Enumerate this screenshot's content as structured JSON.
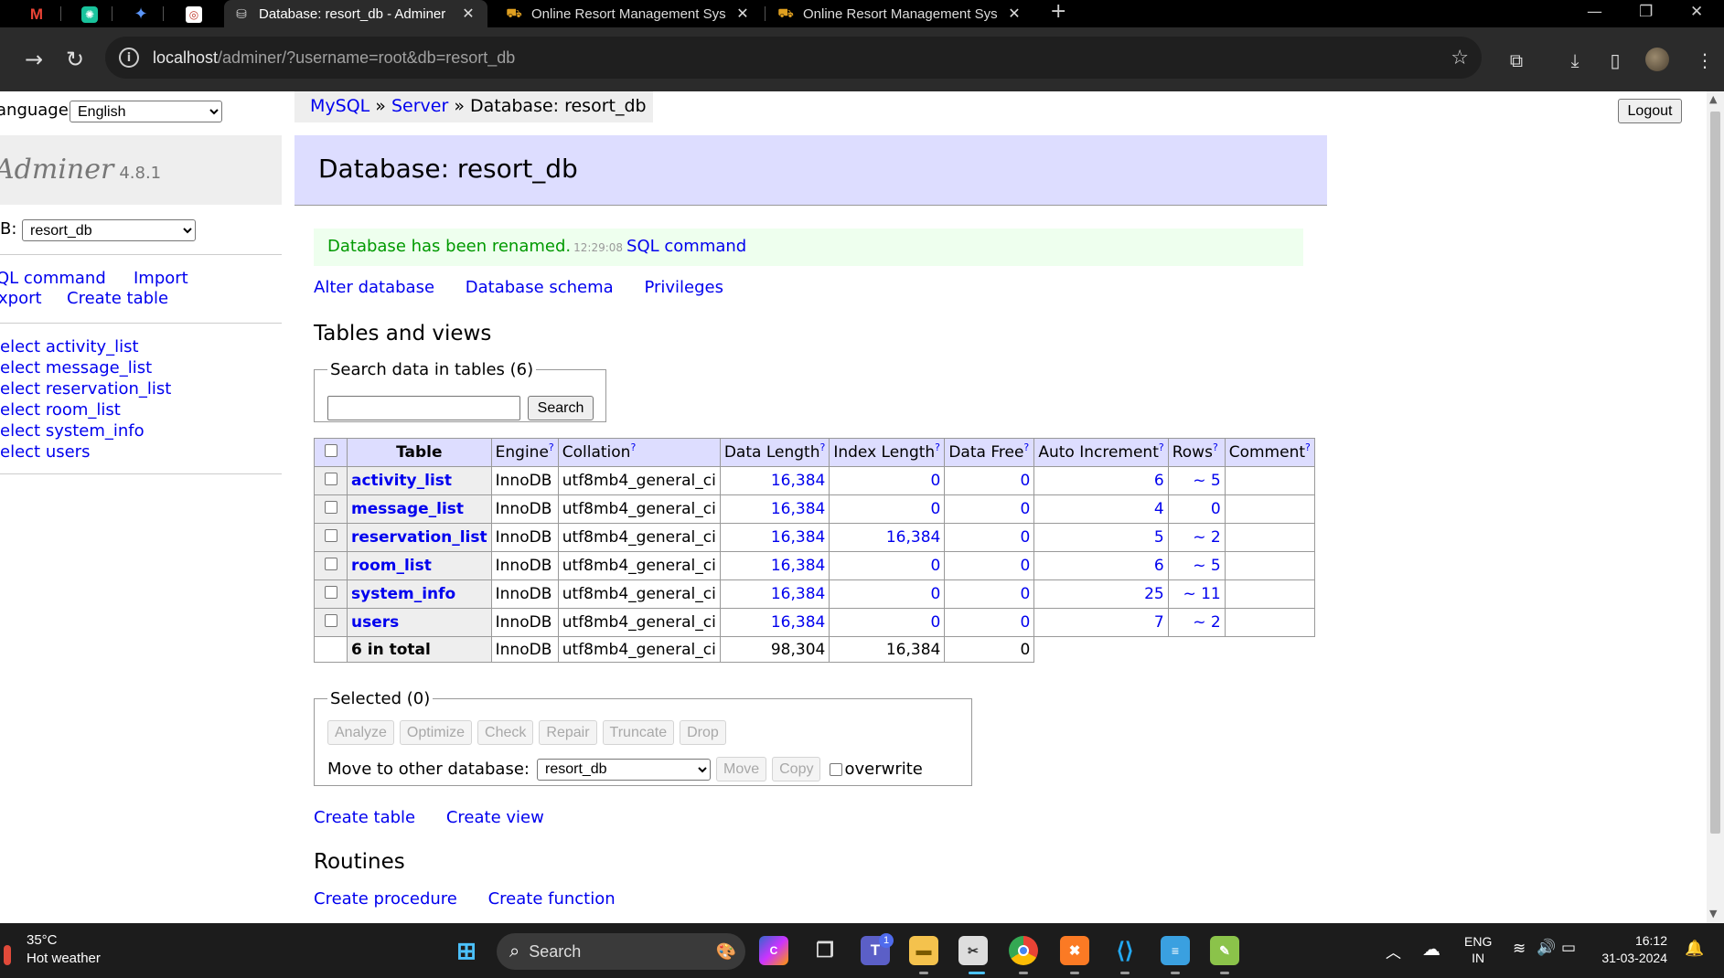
{
  "browser": {
    "pinned_tabs": [
      {
        "icon": "gmail-icon",
        "glyph": "M",
        "color": "#ea4335"
      },
      {
        "icon": "chatgpt-icon",
        "glyph": "✺",
        "color": "#10a37f"
      },
      {
        "icon": "gemini-icon",
        "glyph": "✦",
        "color": "#4f8df7"
      },
      {
        "icon": "pocket-icon",
        "glyph": "◎",
        "color": "#e0e0e0"
      }
    ],
    "tabs": [
      {
        "title": "Database: resort_db - Adminer",
        "active": true
      },
      {
        "title": "Online Resort Management Sys",
        "active": false
      },
      {
        "title": "Online Resort Management Sys",
        "active": false
      }
    ],
    "url_host": "localhost",
    "url_path": "/adminer/?username=root&db=resort_db"
  },
  "menu": {
    "language_label": "anguage:",
    "language_value": "English",
    "brand": "Adminer",
    "version": "4.8.1",
    "db_label": "B:",
    "db_value": "resort_db",
    "links": [
      {
        "label": "QL command",
        "name": "sql-command-link"
      },
      {
        "label": "Import",
        "name": "import-link"
      },
      {
        "label": "xport",
        "name": "export-link"
      },
      {
        "label": "Create table",
        "name": "create-table-link"
      }
    ],
    "tables": [
      "elect activity_list",
      "elect message_list",
      "elect reservation_list",
      "elect room_list",
      "elect system_info",
      "elect users"
    ]
  },
  "breadcrumb": {
    "mysql": "MySQL",
    "sep1": "»",
    "server": "Server",
    "sep2": "»",
    "current": "Database: resort_db"
  },
  "logout_label": "Logout",
  "heading": "Database: resort_db",
  "message": {
    "text": "Database has been renamed.",
    "time": "12:29:08",
    "link": "SQL command"
  },
  "db_links": [
    "Alter database",
    "Database schema",
    "Privileges"
  ],
  "tables_heading": "Tables and views",
  "search": {
    "legend": "Search data in tables (6)",
    "button": "Search"
  },
  "table": {
    "headers": {
      "table": "Table",
      "engine": "Engine",
      "collation": "Collation",
      "data_length": "Data Length",
      "index_length": "Index Length",
      "data_free": "Data Free",
      "auto_increment": "Auto Increment",
      "rows": "Rows",
      "comment": "Comment",
      "help": "?"
    },
    "rows": [
      {
        "name": "activity_list",
        "engine": "InnoDB",
        "collation": "utf8mb4_general_ci",
        "data_length": "16,384",
        "index_length": "0",
        "data_free": "0",
        "auto_increment": "6",
        "rows": "~ 5",
        "comment": ""
      },
      {
        "name": "message_list",
        "engine": "InnoDB",
        "collation": "utf8mb4_general_ci",
        "data_length": "16,384",
        "index_length": "0",
        "data_free": "0",
        "auto_increment": "4",
        "rows": "0",
        "comment": ""
      },
      {
        "name": "reservation_list",
        "engine": "InnoDB",
        "collation": "utf8mb4_general_ci",
        "data_length": "16,384",
        "index_length": "16,384",
        "data_free": "0",
        "auto_increment": "5",
        "rows": "~ 2",
        "comment": ""
      },
      {
        "name": "room_list",
        "engine": "InnoDB",
        "collation": "utf8mb4_general_ci",
        "data_length": "16,384",
        "index_length": "0",
        "data_free": "0",
        "auto_increment": "6",
        "rows": "~ 5",
        "comment": ""
      },
      {
        "name": "system_info",
        "engine": "InnoDB",
        "collation": "utf8mb4_general_ci",
        "data_length": "16,384",
        "index_length": "0",
        "data_free": "0",
        "auto_increment": "25",
        "rows": "~ 11",
        "comment": ""
      },
      {
        "name": "users",
        "engine": "InnoDB",
        "collation": "utf8mb4_general_ci",
        "data_length": "16,384",
        "index_length": "0",
        "data_free": "0",
        "auto_increment": "7",
        "rows": "~ 2",
        "comment": ""
      }
    ],
    "total": {
      "label": "6 in total",
      "engine": "InnoDB",
      "collation": "utf8mb4_general_ci",
      "data_length": "98,304",
      "index_length": "16,384",
      "data_free": "0"
    }
  },
  "selected": {
    "legend": "Selected (0)",
    "buttons": [
      "Analyze",
      "Optimize",
      "Check",
      "Repair",
      "Truncate",
      "Drop"
    ],
    "move_label": "Move to other database:",
    "move_db": "resort_db",
    "move_button": "Move",
    "copy_button": "Copy",
    "overwrite_label": "overwrite"
  },
  "create_links": [
    "Create table",
    "Create view"
  ],
  "routines_heading": "Routines",
  "routine_links": [
    "Create procedure",
    "Create function"
  ],
  "taskbar": {
    "temperature": "35°C",
    "weather": "Hot weather",
    "search_label": "Search",
    "lang1": "ENG",
    "lang2": "IN",
    "time": "16:12",
    "date": "31-03-2024",
    "teams_badge": "1"
  }
}
